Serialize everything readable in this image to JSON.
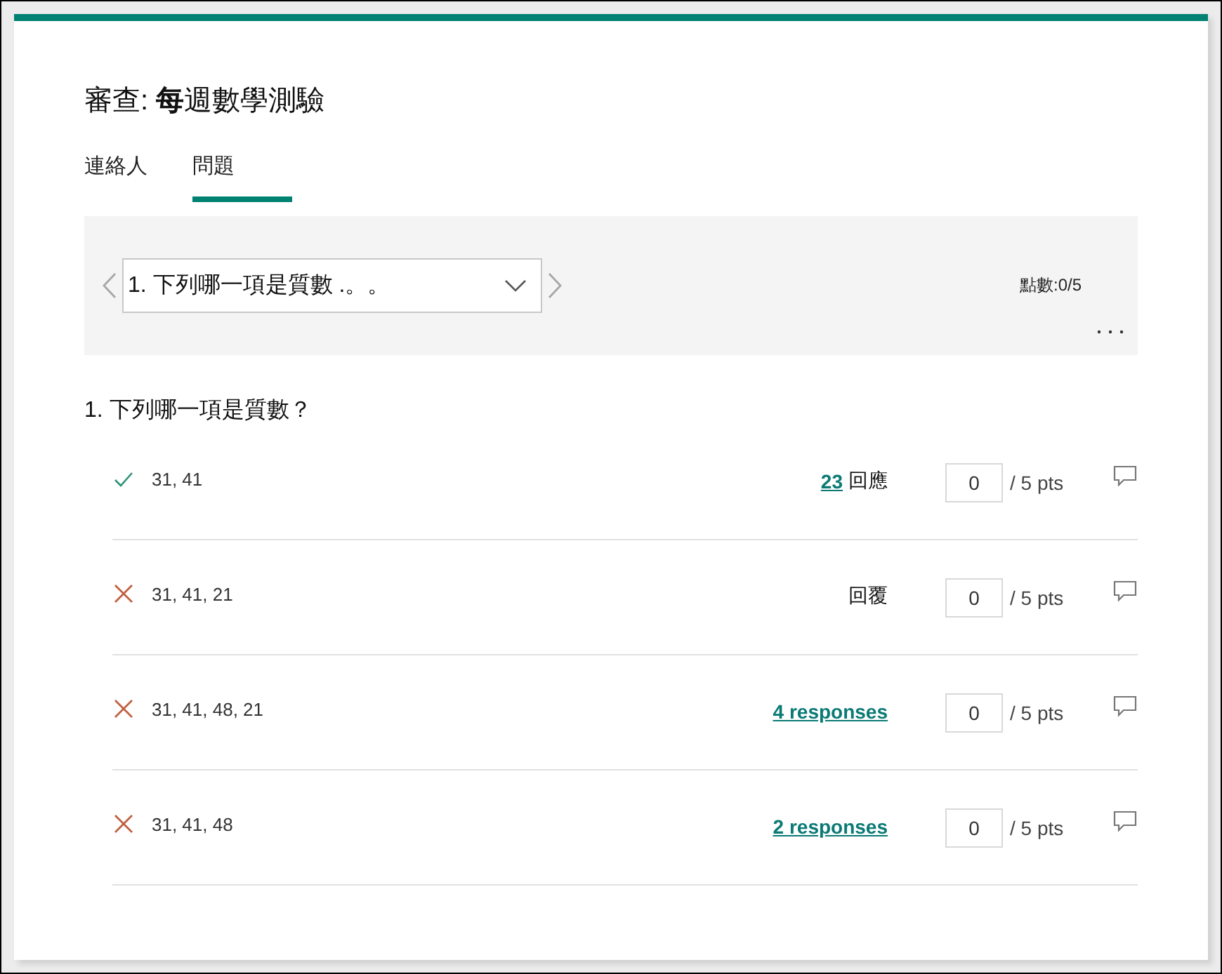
{
  "title": "審查: **每**週數學測驗",
  "tabs": [
    {
      "label": "連絡人",
      "selected": false
    },
    {
      "label": "問題",
      "selected": true
    }
  ],
  "question_nav": {
    "dropdown": {
      "value": "1. 下列哪一項是質數 .。。"
    },
    "points": "點數:0/5"
  },
  "question": {
    "title": "1. 下列哪一項是質數？",
    "answers": [
      {
        "correct": true,
        "text": "31, 41",
        "responses_link": "23",
        "responses_label": "回應",
        "score": "0",
        "max_points": "/ 5 pts"
      },
      {
        "correct": false,
        "text": "31, 41, 21",
        "responses_label": "回覆",
        "score": "0",
        "max_points": "/ 5 pts"
      },
      {
        "correct": false,
        "text": "31, 41, 48, 21",
        "responses_link": "4 responses",
        "score": "0",
        "max_points": "/ 5 pts"
      },
      {
        "correct": false,
        "text": "31, 41, 48",
        "responses_link": "2 responses",
        "score": "0",
        "max_points": "/ 5 pts"
      }
    ]
  }
}
